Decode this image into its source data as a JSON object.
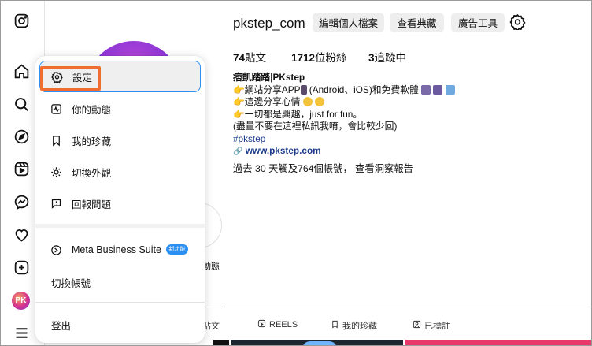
{
  "profile": {
    "username": "pkstep_com",
    "buttons": [
      "編輯個人檔案",
      "查看典藏",
      "廣告工具"
    ],
    "stats": {
      "posts_count": "74",
      "posts_label": "貼文",
      "followers_count": "1712",
      "followers_label": "位粉絲",
      "following_prefix": "3",
      "following_label": "追蹤中"
    },
    "bio": {
      "name": "痞凱踏踏|PKstep",
      "line1": "網站分享APP",
      "line1b": "(Android、iOS)和免費軟體",
      "line2": "這邊分享心情",
      "line3": "一切都是興趣，just for fun。",
      "line4": "(盡量不要在這裡私訊我唷，會比較少回)",
      "hashtag": "#pkstep",
      "link": "www.pkstep.com"
    },
    "reach_text": "過去 30 天觸及764個帳號，",
    "insights_link": "查看洞察報告",
    "highlight_label": "動態"
  },
  "rail": {
    "avatar_initials": "PK"
  },
  "tabs": [
    {
      "label": "貼文",
      "icon": "grid-icon"
    },
    {
      "label": "REELS",
      "icon": "reels-icon"
    },
    {
      "label": "我的珍藏",
      "icon": "bookmark-icon"
    },
    {
      "label": "已標註",
      "icon": "tag-icon"
    }
  ],
  "menu": {
    "items": [
      {
        "label": "設定",
        "icon": "gear-icon"
      },
      {
        "label": "你的動態",
        "icon": "activity-icon"
      },
      {
        "label": "我的珍藏",
        "icon": "bookmark-icon"
      },
      {
        "label": "切換外觀",
        "icon": "sun-icon"
      },
      {
        "label": "回報問題",
        "icon": "report-icon"
      }
    ],
    "meta_label": "Meta Business Suite",
    "meta_badge": "新功能",
    "switch_label": "切換帳號",
    "logout_label": "登出"
  },
  "colors": {
    "accent_blue": "#2b8ff2",
    "highlight_orange": "#ef6d2f"
  }
}
